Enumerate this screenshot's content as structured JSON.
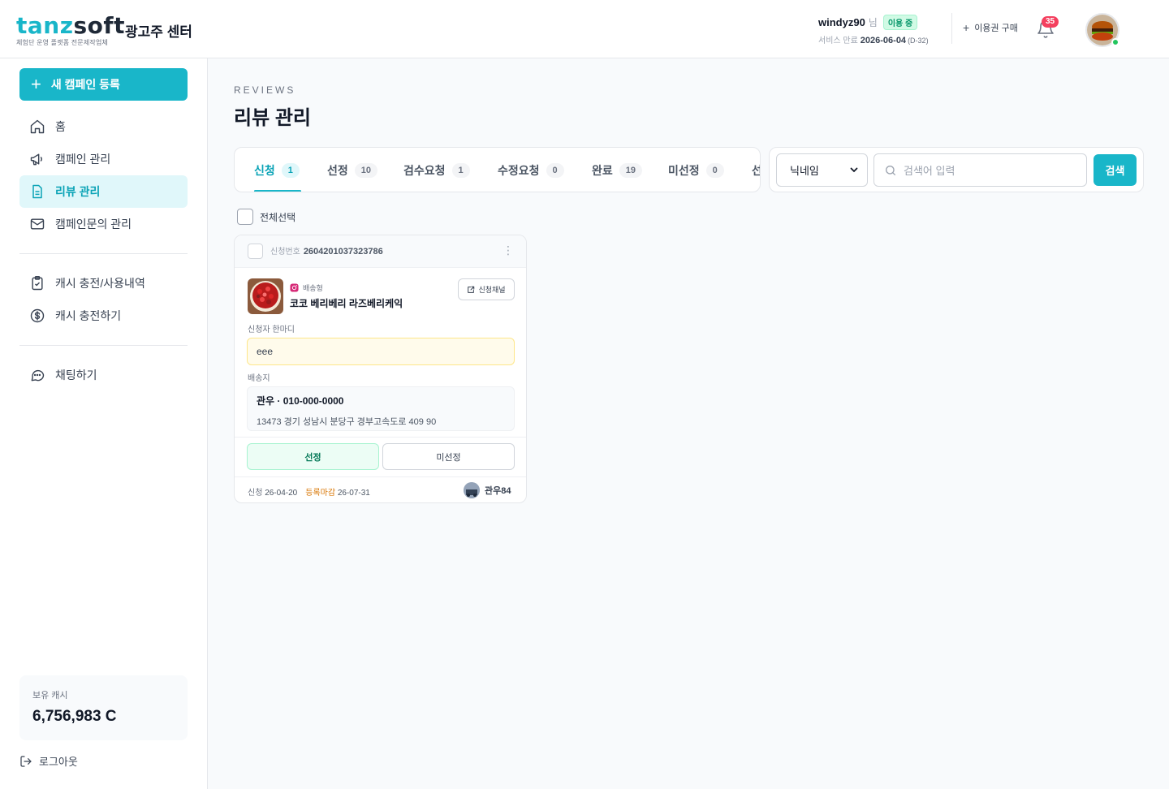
{
  "header": {
    "logo_part1": "tanz",
    "logo_part2": "soft",
    "logo_tagline": "체험단 운영 플랫폼 전문제작업체",
    "center_name": "광고주 센터",
    "user_id": "windyz90",
    "user_suffix": "님",
    "status_badge": "이용 중",
    "expire_label": "서비스 만료",
    "expire_date": "2026-06-04",
    "expire_dday": "(D-32)",
    "buy_label": "이용권 구매",
    "notification_count": "35",
    "colors": {
      "accent": "#19b6c9",
      "badge_red": "#f43f5e",
      "online": "#22c55e"
    }
  },
  "sidebar": {
    "new_campaign": "새 캠페인 등록",
    "items": [
      {
        "label": "홈",
        "icon": "home-icon"
      },
      {
        "label": "캠페인 관리",
        "icon": "megaphone-icon"
      },
      {
        "label": "리뷰 관리",
        "icon": "document-icon",
        "active": true
      },
      {
        "label": "캠페인문의 관리",
        "icon": "mail-icon"
      },
      {
        "label": "캐시 충전/사용내역",
        "icon": "clipboard-check-icon"
      },
      {
        "label": "캐시 충전하기",
        "icon": "dollar-circle-icon"
      },
      {
        "label": "채팅하기",
        "icon": "chat-icon"
      }
    ],
    "cash_label": "보유 캐시",
    "cash_value": "6,756,983 C",
    "logout": "로그아웃"
  },
  "main": {
    "eyebrow": "REVIEWS",
    "title": "리뷰 관리",
    "tabs": [
      {
        "label": "신청",
        "count": "1",
        "active": true
      },
      {
        "label": "선정",
        "count": "10"
      },
      {
        "label": "검수요청",
        "count": "1"
      },
      {
        "label": "수정요청",
        "count": "0"
      },
      {
        "label": "완료",
        "count": "19"
      },
      {
        "label": "미선정",
        "count": "0"
      },
      {
        "label": "선"
      }
    ],
    "search": {
      "select_value": "닉네임",
      "placeholder": "검색어 입력",
      "button": "검색"
    },
    "select_all": "전체선택",
    "review_card": {
      "app_no_label": "신청번호",
      "app_no": "2604201037323786",
      "more": "⋮",
      "type": "배송형",
      "product": "코코 베리베리 라즈베리케익",
      "channel_btn": "신청채널",
      "comment_label": "신청자 한마디",
      "comment": "eee",
      "address_label": "배송지",
      "address_name": "관우 · 010-000-0000",
      "address_line": "13473 경기 성남시 분당구 경부고속도로 409 90",
      "select_btn": "선정",
      "unselect_btn": "미선정",
      "apply_label": "신청",
      "apply_date": "26-04-20",
      "deadline_label": "등록마감",
      "deadline_date": "26-07-31",
      "user": "관우84"
    }
  }
}
